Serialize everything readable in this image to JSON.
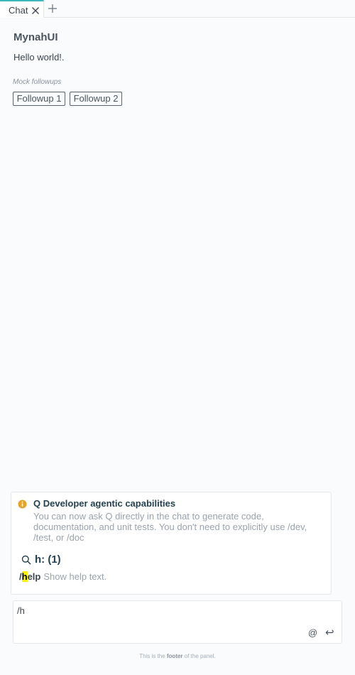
{
  "tabs": [
    {
      "label": "Chat",
      "active": true
    }
  ],
  "colors": {
    "accent": "#3fb7bf",
    "highlight": "#fff200",
    "info": "#e4a42a"
  },
  "chat": {
    "title": "MynahUI",
    "message": "Hello world!.",
    "followups_title": "Mock followups",
    "followups": [
      "Followup 1",
      "Followup 2"
    ]
  },
  "overlay": {
    "info_icon": "info-icon",
    "info_title": "Q Developer agentic capabilities",
    "info_body": "You can now ask Q directly in the chat to generate code, documentation, and unit tests. You don't need to explicitly use /dev, /test, or /doc",
    "search_icon": "search-icon",
    "search_title": "h: (1)",
    "commands": [
      {
        "prefix": "/",
        "match": "h",
        "rest": "elp",
        "description": "Show help text."
      }
    ]
  },
  "prompt": {
    "value": "/h",
    "at_label": "@",
    "send_label": "↩"
  },
  "footer": {
    "before": "This is the ",
    "bold": "footer",
    "after": " of the panel."
  }
}
